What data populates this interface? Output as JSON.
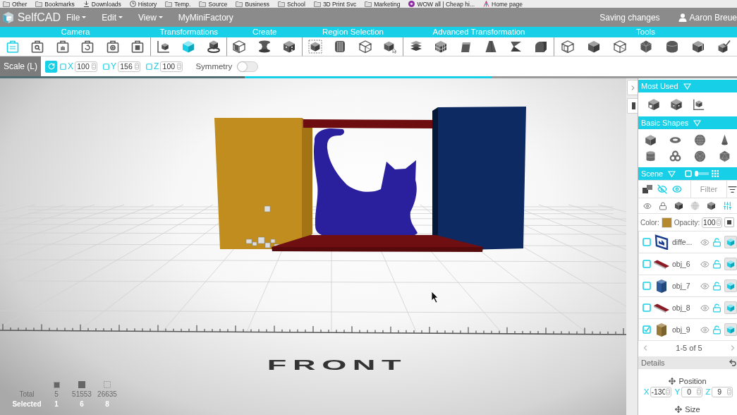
{
  "bookmarks_bar": {
    "items": [
      {
        "label": "Other",
        "kind": "folder"
      },
      {
        "label": "Bookmarks",
        "kind": "folder"
      },
      {
        "label": "Downloads",
        "kind": "download"
      },
      {
        "label": "History",
        "kind": "history"
      },
      {
        "label": "Temp.",
        "kind": "folder"
      },
      {
        "label": "Source",
        "kind": "folder"
      },
      {
        "label": "Business",
        "kind": "folder"
      },
      {
        "label": "School",
        "kind": "folder"
      },
      {
        "label": "3D Print Svc",
        "kind": "folder"
      },
      {
        "label": "Marketing",
        "kind": "folder"
      },
      {
        "label": "WOW all | Cheap hi...",
        "kind": "site"
      },
      {
        "label": "Home page",
        "kind": "home"
      }
    ]
  },
  "app_header": {
    "logo": "SelfCAD",
    "menus": [
      {
        "label": "File",
        "has_menu": true
      },
      {
        "label": "Edit",
        "has_menu": true
      },
      {
        "label": "View",
        "has_menu": true
      },
      {
        "label": "MyMiniFactory",
        "has_menu": false
      }
    ],
    "status": "Saving changes",
    "user": "Aaron Breue"
  },
  "ribbon": {
    "groups": [
      {
        "label": "Camera",
        "tools": [
          {
            "selected": true
          },
          {
            "selected": false
          },
          {
            "selected": false
          },
          {
            "selected": false
          },
          {
            "selected": false
          },
          {
            "selected": false
          }
        ]
      },
      {
        "label": "Transformations",
        "tools": [
          {
            "selected": false
          },
          {
            "selected": true
          },
          {
            "selected": false
          }
        ]
      },
      {
        "label": "Create",
        "tools": [
          {
            "selected": false
          },
          {
            "selected": false
          },
          {
            "selected": false
          }
        ]
      },
      {
        "label": "Region Selection",
        "tools": [
          {
            "selected": false
          },
          {
            "selected": false
          },
          {
            "selected": false
          },
          {
            "selected": false
          }
        ]
      },
      {
        "label": "Advanced Transformation",
        "tools": [
          {
            "selected": false
          },
          {
            "selected": false
          },
          {
            "selected": false
          },
          {
            "selected": false
          },
          {
            "selected": false
          },
          {
            "selected": false
          }
        ]
      },
      {
        "label": "Tools",
        "tools": [
          {
            "selected": false
          },
          {
            "selected": false
          },
          {
            "selected": false
          },
          {
            "selected": false
          },
          {
            "selected": false
          },
          {
            "selected": false
          },
          {
            "selected": false
          }
        ]
      }
    ]
  },
  "scale_bar": {
    "title": "Scale (L)",
    "axes": [
      {
        "axis": "X",
        "checked": false,
        "value": "100"
      },
      {
        "axis": "Y",
        "checked": false,
        "value": "156"
      },
      {
        "axis": "Z",
        "checked": false,
        "value": "100"
      }
    ],
    "symmetry": {
      "label": "Symmetry",
      "on": false
    }
  },
  "viewport": {
    "floor_label": "FRONT",
    "stats": {
      "rows": [
        {
          "label": "Total",
          "kind": "total",
          "values": [
            "5",
            "51553",
            "26635"
          ]
        },
        {
          "label": "Selected",
          "kind": "selected",
          "values": [
            "1",
            "6",
            "8"
          ]
        }
      ]
    }
  },
  "panel": {
    "most_used": {
      "title": "Most Used"
    },
    "basic_shapes": {
      "title": "Basic Shapes"
    },
    "scene": {
      "title": "Scene",
      "filter_placeholder": "Filter",
      "color_label": "Color:",
      "color": "#b58a2e",
      "opacity_label": "Opacity:",
      "opacity": "100",
      "objects": [
        {
          "name": "diffe...",
          "kind": "frame",
          "color": "#1f3f8f",
          "checked": false
        },
        {
          "name": "obj_6",
          "kind": "plank",
          "color": "#8a1a24",
          "checked": false
        },
        {
          "name": "obj_7",
          "kind": "block",
          "color": "#2c5a9a",
          "checked": false
        },
        {
          "name": "obj_8",
          "kind": "plank",
          "color": "#8a1a24",
          "checked": false
        },
        {
          "name": "obj_9",
          "kind": "block",
          "color": "#9a7a3a",
          "checked": true
        }
      ],
      "pagination": "1-5 of 5"
    },
    "details": {
      "title": "Details",
      "position": {
        "label": "Position",
        "fields": [
          {
            "axis": "X",
            "value": "-130"
          },
          {
            "axis": "Y",
            "value": "0"
          },
          {
            "axis": "Z",
            "value": "9"
          }
        ]
      },
      "size": {
        "label": "Size"
      }
    }
  }
}
